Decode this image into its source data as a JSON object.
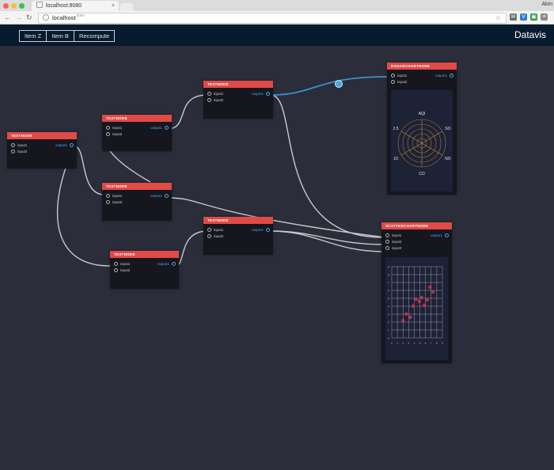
{
  "browser": {
    "tab_title": "localhost:8080",
    "tab_close": "×",
    "url_host": "localhost",
    "url_port": ":8080",
    "user_label": "Akin",
    "back": "←",
    "forward": "→",
    "reload": "↻",
    "star": "☆",
    "extensions": [
      {
        "name": "ext-1",
        "glyph": "✉",
        "color": "#6d6d6d"
      },
      {
        "name": "ext-2",
        "glyph": "V",
        "color": "#2f7dd3"
      },
      {
        "name": "ext-3",
        "glyph": "▣",
        "color": "#2a9d3e"
      },
      {
        "name": "ext-4",
        "glyph": "≡",
        "color": "#8a8a8a"
      }
    ]
  },
  "appbar": {
    "menu": [
      "Item Z",
      "Item B",
      "Recompute"
    ],
    "brand": "Datavis"
  },
  "colors": {
    "node_header": "#e04a47",
    "wire": "#d9dade",
    "active_wire": "#3b8fd0",
    "output_port": "#4aa6e0",
    "radar": "#d08a3a",
    "scatter_point": "#c0304a"
  },
  "nodes": [
    {
      "id": "textnode-a",
      "title": "TEXTNODE",
      "inputs": [
        "input1",
        "input2"
      ],
      "output": "output1"
    },
    {
      "id": "textnode-b",
      "title": "TEXTNODE",
      "inputs": [
        "input1",
        "input2"
      ],
      "output": "output1"
    },
    {
      "id": "textnode-c",
      "title": "TEXTNODE",
      "inputs": [
        "input1",
        "input2"
      ],
      "output": "output1"
    },
    {
      "id": "textnode-d",
      "title": "TEXTNODE",
      "inputs": [
        "input1",
        "input2"
      ],
      "output": "output1"
    },
    {
      "id": "textnode-e",
      "title": "TEXTNODE",
      "inputs": [
        "input1",
        "input2"
      ],
      "output": "output1"
    },
    {
      "id": "textnode-f",
      "title": "TEXTNODE",
      "inputs": [
        "input1",
        "input2"
      ],
      "output": "output1"
    },
    {
      "id": "radar",
      "title": "RADARCHARTNODE",
      "inputs": [
        "input1",
        "input2"
      ],
      "output": "output1"
    },
    {
      "id": "scatter",
      "title": "SCATTERCHARTNODE",
      "inputs": [
        "input1",
        "input2",
        "input3"
      ],
      "output": "output1"
    }
  ],
  "radar_labels": [
    "AQI",
    "SO",
    "NO",
    "CO",
    "10",
    "2.5"
  ],
  "scatter_ticks": [
    "0",
    "1",
    "2",
    "3",
    "4",
    "5",
    "6",
    "7",
    "8",
    "9"
  ],
  "scatter_points": [
    {
      "x": 2.0,
      "y": 2.2
    },
    {
      "x": 2.6,
      "y": 3.0
    },
    {
      "x": 3.3,
      "y": 2.6
    },
    {
      "x": 3.8,
      "y": 4.0
    },
    {
      "x": 4.3,
      "y": 4.9
    },
    {
      "x": 4.9,
      "y": 4.6
    },
    {
      "x": 5.3,
      "y": 5.1
    },
    {
      "x": 5.8,
      "y": 4.1
    },
    {
      "x": 6.3,
      "y": 4.8
    },
    {
      "x": 6.8,
      "y": 6.4
    },
    {
      "x": 7.3,
      "y": 5.8
    }
  ]
}
